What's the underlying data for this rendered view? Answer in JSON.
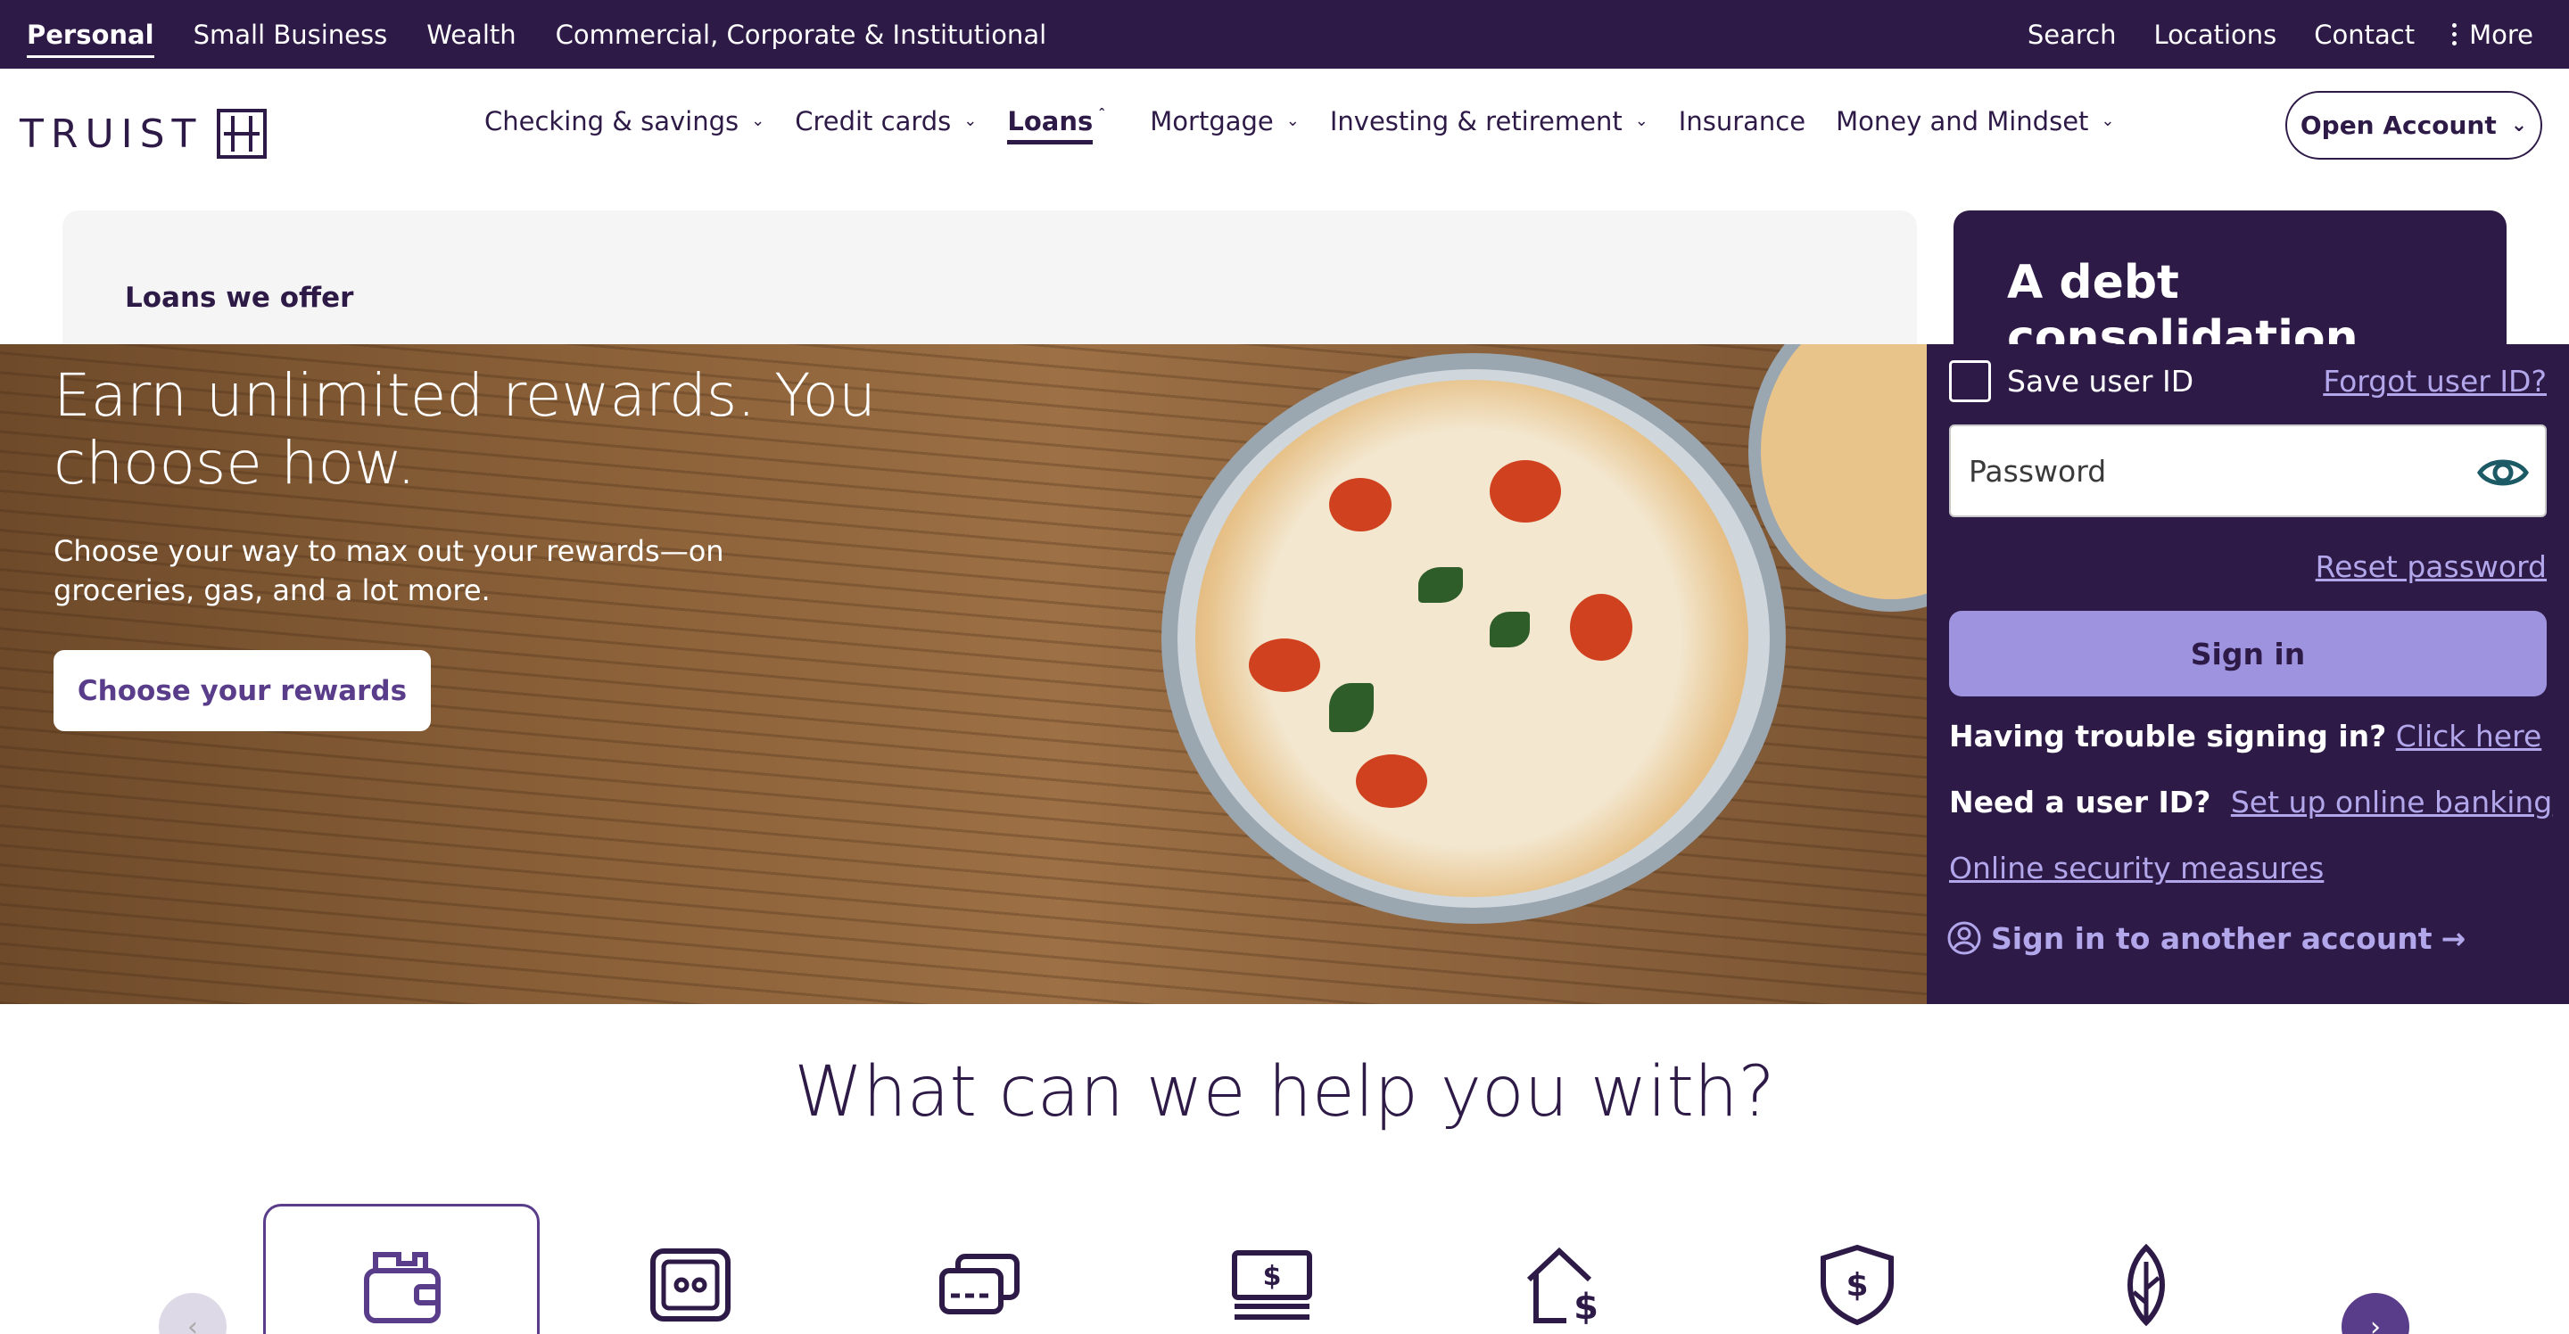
{
  "utility_nav": {
    "left": [
      "Personal",
      "Small Business",
      "Wealth",
      "Commercial, Corporate & Institutional"
    ],
    "right": [
      "Search",
      "Locations",
      "Contact",
      "More"
    ]
  },
  "brand": {
    "logo_text": "TRUIST"
  },
  "main_nav": {
    "items": [
      "Checking & savings",
      "Credit cards",
      "Loans",
      "Mortgage",
      "Investing & retirement",
      "Insurance",
      "Money and Mindset"
    ],
    "open_account": "Open Account"
  },
  "loans_menu": {
    "title": "Loans we offer",
    "promo_title": "A debt consolidation"
  },
  "hero": {
    "title": "Earn unlimited rewards. You choose how.",
    "subtitle": "Choose your way to max out your rewards—on groceries, gas, and a lot more.",
    "button": "Choose your rewards"
  },
  "signin": {
    "save_user_id": "Save user ID",
    "forgot_user_id": "Forgot user ID?",
    "password_placeholder": "Password",
    "reset_password": "Reset password",
    "sign_in": "Sign in",
    "trouble_q": "Having trouble signing in?",
    "trouble_link": "Click here",
    "need_q": "Need a user ID?",
    "need_link": "Set up online banking",
    "security_link": "Online security measures",
    "another_account": "Sign in to another account"
  },
  "help": {
    "title": "What can we help you with?"
  },
  "colors": {
    "brand_purple": "#2e1a47",
    "accent_lavender": "#b3a7ec",
    "signin_button": "#9d93de",
    "icon_purple": "#5a3d8a"
  }
}
